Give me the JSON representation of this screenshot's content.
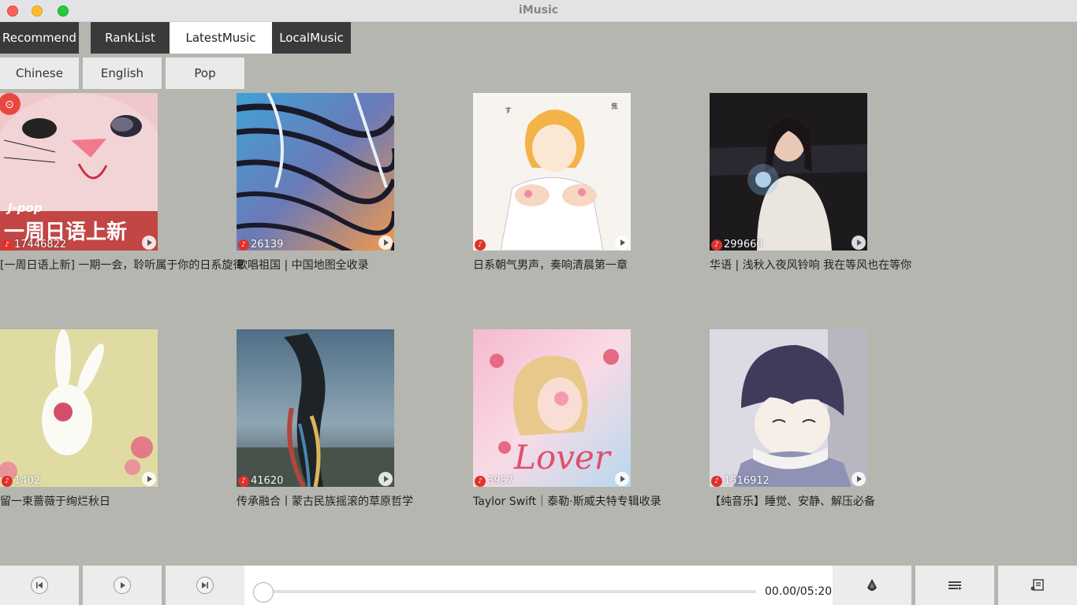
{
  "window": {
    "title": "iMusic"
  },
  "tabs": [
    {
      "label": "Recommend",
      "active": false
    },
    {
      "label": "RankList",
      "active": false
    },
    {
      "label": "LatestMusic",
      "active": true
    },
    {
      "label": "LocalMusic",
      "active": false
    }
  ],
  "subtabs": [
    "Chinese",
    "English",
    "Pop"
  ],
  "playlists": [
    {
      "count": "17446822",
      "title": "[一周日语上新] 一期一会，聆听属于你的日系旋律",
      "cover_text_small": "J-pop",
      "cover_text_big": "一周日语上新",
      "cover_icon": "netease-logo-icon"
    },
    {
      "count": "26139",
      "title": "歌唱祖国 | 中国地图全收录"
    },
    {
      "count": "",
      "title": "日系朝气男声，奏响清晨第一章"
    },
    {
      "count": "299660",
      "title": "华语 | 浅秋入夜风铃响 我在等风也在等你"
    },
    {
      "count": "1402",
      "title": "留一束蔷薇于绚烂秋日"
    },
    {
      "count": "41620",
      "title": "传承融合丨蒙古民族摇滚的草原哲学"
    },
    {
      "count": "3957",
      "title": "Taylor Swift｜泰勒·斯威夫特专辑收录",
      "cover_text_big": "Lover"
    },
    {
      "count": "1516912",
      "title": "【纯音乐】睡觉、安静、解压必备"
    }
  ],
  "player": {
    "time": "00.00/05:20",
    "progress": 0,
    "icons": [
      "previous-icon",
      "play-icon",
      "next-icon",
      "volume-icon",
      "playlist-icon",
      "lyrics-icon"
    ]
  },
  "colors": {
    "tab_bg": "#3a3a3a",
    "active_tab_bg": "#ffffff",
    "background": "#b5b6b0",
    "accent_red": "#e0312a"
  }
}
